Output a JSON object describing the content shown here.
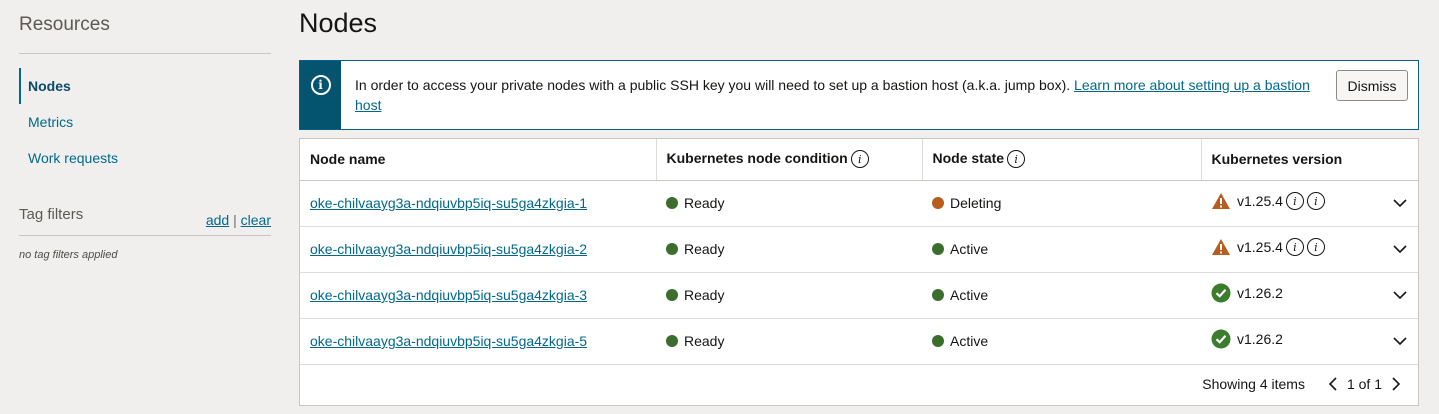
{
  "sidebar": {
    "title": "Resources",
    "items": [
      {
        "label": "Nodes",
        "active": true
      },
      {
        "label": "Metrics",
        "active": false
      },
      {
        "label": "Work requests",
        "active": false
      }
    ],
    "tag_filters": {
      "title": "Tag filters",
      "add_label": "add",
      "separator": "|",
      "clear_label": "clear",
      "empty_text": "no tag filters applied"
    }
  },
  "main": {
    "title": "Nodes",
    "banner": {
      "text": "In order to access your private nodes with a public SSH key you will need to set up a bastion host (a.k.a. jump box). ",
      "link_text": "Learn more about setting up a bastion host",
      "dismiss_label": "Dismiss",
      "icon": "info-icon"
    },
    "table": {
      "headers": [
        "Node name",
        "Kubernetes node condition",
        "Node state",
        "Kubernetes version"
      ],
      "rows": [
        {
          "name": "oke-chilvaayg3a-ndqiuvbp5iq-su5ga4zkgia-1",
          "condition": "Ready",
          "state": "Deleting",
          "version": "v1.25.4",
          "version_status": "warning"
        },
        {
          "name": "oke-chilvaayg3a-ndqiuvbp5iq-su5ga4zkgia-2",
          "condition": "Ready",
          "state": "Active",
          "version": "v1.25.4",
          "version_status": "warning"
        },
        {
          "name": "oke-chilvaayg3a-ndqiuvbp5iq-su5ga4zkgia-3",
          "condition": "Ready",
          "state": "Active",
          "version": "v1.26.2",
          "version_status": "ok"
        },
        {
          "name": "oke-chilvaayg3a-ndqiuvbp5iq-su5ga4zkgia-5",
          "condition": "Ready",
          "state": "Active",
          "version": "v1.26.2",
          "version_status": "ok"
        }
      ],
      "footer": {
        "showing": "Showing 4 items",
        "page": "1 of 1"
      }
    }
  },
  "colors": {
    "ready": "#3b6e2c",
    "active": "#3b6e2c",
    "deleting": "#b85c1f",
    "warning": "#b85c1f",
    "ok": "#3b7d2c",
    "link": "#00688c",
    "banner_strip": "#04536f"
  }
}
